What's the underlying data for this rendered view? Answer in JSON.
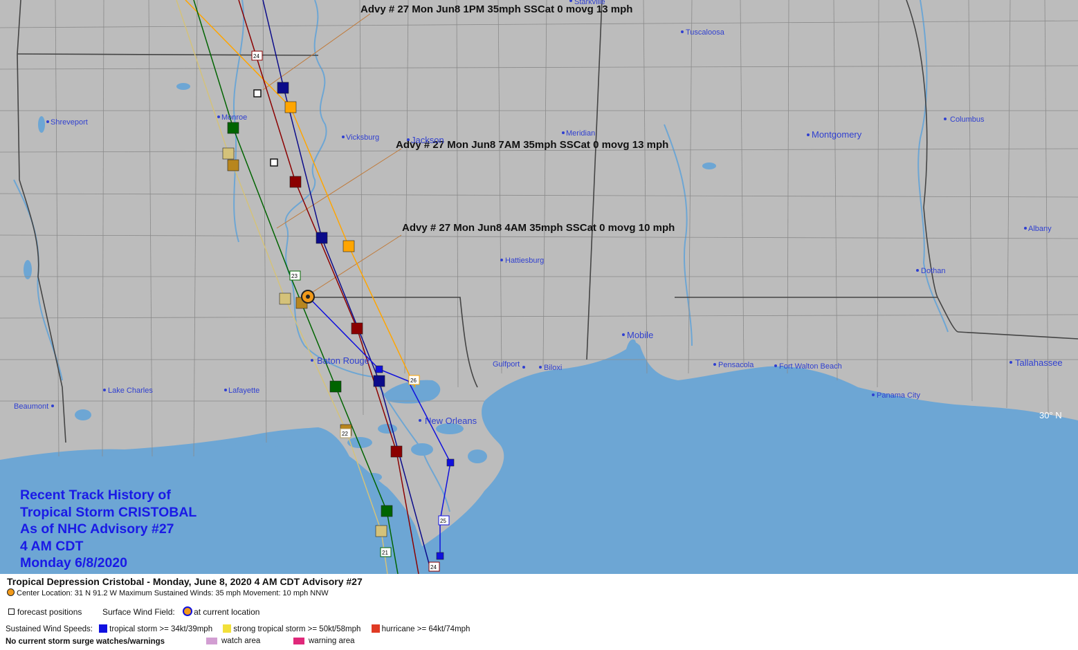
{
  "map": {
    "cities": [
      {
        "name": "Shreveport",
        "size": "small"
      },
      {
        "name": "Monroe",
        "size": "small"
      },
      {
        "name": "Vicksburg",
        "size": "small"
      },
      {
        "name": "Jackson",
        "size": "large"
      },
      {
        "name": "Meridian",
        "size": "small"
      },
      {
        "name": "Tuscaloosa",
        "size": "small"
      },
      {
        "name": "Starkville",
        "size": "small"
      },
      {
        "name": "Montgomery",
        "size": "large"
      },
      {
        "name": "Columbus",
        "size": "small"
      },
      {
        "name": "Albany",
        "size": "small"
      },
      {
        "name": "Dothan",
        "size": "small"
      },
      {
        "name": "Hattiesburg",
        "size": "small"
      },
      {
        "name": "Mobile",
        "size": "large"
      },
      {
        "name": "Baton Rouge",
        "size": "large"
      },
      {
        "name": "Gulfport",
        "size": "small"
      },
      {
        "name": "Biloxi",
        "size": "small"
      },
      {
        "name": "Pensacola",
        "size": "small"
      },
      {
        "name": "Fort Walton Beach",
        "size": "small"
      },
      {
        "name": "Tallahassee",
        "size": "large"
      },
      {
        "name": "Panama City",
        "size": "small"
      },
      {
        "name": "New Orleans",
        "size": "large"
      },
      {
        "name": "Lake Charles",
        "size": "small"
      },
      {
        "name": "Lafayette",
        "size": "small"
      },
      {
        "name": "Beaumont",
        "size": "small"
      }
    ],
    "latitude_label": "30° N",
    "advisory_callouts": [
      "Advy # 27 Mon Jun8 1PM  35mph SSCat 0 movg 13 mph",
      "Advy # 27 Mon Jun8 7AM  35mph SSCat 0 movg 13 mph",
      "Advy # 27 Mon Jun8 4AM  35mph SSCat 0 movg 10 mph"
    ],
    "day_markers": [
      "24",
      "23",
      "26",
      "22",
      "25",
      "21",
      "24"
    ],
    "colors": {
      "land": "#bcbcbc",
      "water": "#6da6d4",
      "border": "#555555",
      "city_label": "#2f3fd0",
      "navy_track": "#0b0b8a",
      "orange_track": "#ffa500",
      "green_track": "#006400",
      "khaki_track": "#d4c27a",
      "darkred_track": "#8b0000",
      "blue_track": "#1010dd"
    }
  },
  "title_block": {
    "lines": [
      "Recent Track History of",
      "Tropical Storm CRISTOBAL",
      "As of NHC Advisory #27",
      "4 AM CDT",
      "Monday 6/8/2020"
    ]
  },
  "legend": {
    "headline": "Tropical Depression Cristobal  -  Monday, June 8, 2020  4 AM CDT   Advisory #27",
    "center_info": "Center Location: 31 N  91.2 W   Maximum Sustained Winds: 35 mph  Movement: 10 mph NNW",
    "forecast_positions": "forecast positions",
    "surface_wind_field": "Surface Wind Field:",
    "at_current_location": "at current location",
    "sustained_wind_speeds": "Sustained Wind Speeds:",
    "wind_categories": [
      {
        "label": "tropical storm >= 34kt/39mph",
        "color": "#1010e0"
      },
      {
        "label": "strong tropical storm >= 50kt/58mph",
        "color": "#f2e03a"
      },
      {
        "label": "hurricane >= 64kt/74mph",
        "color": "#e03a24"
      }
    ],
    "no_surge": "No current storm surge watches/warnings",
    "watch_area": {
      "label": "watch area",
      "color": "#d29ed2"
    },
    "warning_area": {
      "label": "warning area",
      "color": "#e0287a"
    }
  }
}
